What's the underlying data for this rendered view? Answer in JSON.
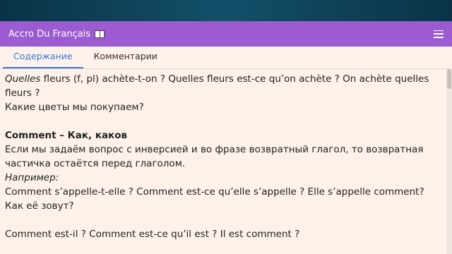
{
  "app": {
    "title": "Accro Du Français"
  },
  "tabs": [
    {
      "label": "Содержание"
    },
    {
      "label": "Комментарии"
    }
  ],
  "content": {
    "l1_italic": "Quelles",
    "l1_rest": " fleurs (f, pl) achète-t-on ? Quelles fleurs est-ce qu’on achète ? On achète quelles fleurs ?",
    "l2": "Какие цветы мы покупаем?",
    "heading": "Comment – Как, каков",
    "para1": "Если мы задаём вопрос с инверсией и во фразе возвратный глагол, то возвратная частичка остаётся перед глаголом.",
    "example_label": "Например:",
    "example1": "Comment s’appelle-t-elle ? Comment est-ce qu’elle s’appelle ? Elle s’appelle comment?",
    "example1_tr": "Как её зовут?",
    "example2": "Comment est-il ? Comment est-ce qu’il est ? Il est comment ?"
  },
  "colors": {
    "header": "#9c5bd1",
    "active_tab": "#3a7bd5",
    "background": "#fdf1ea"
  }
}
